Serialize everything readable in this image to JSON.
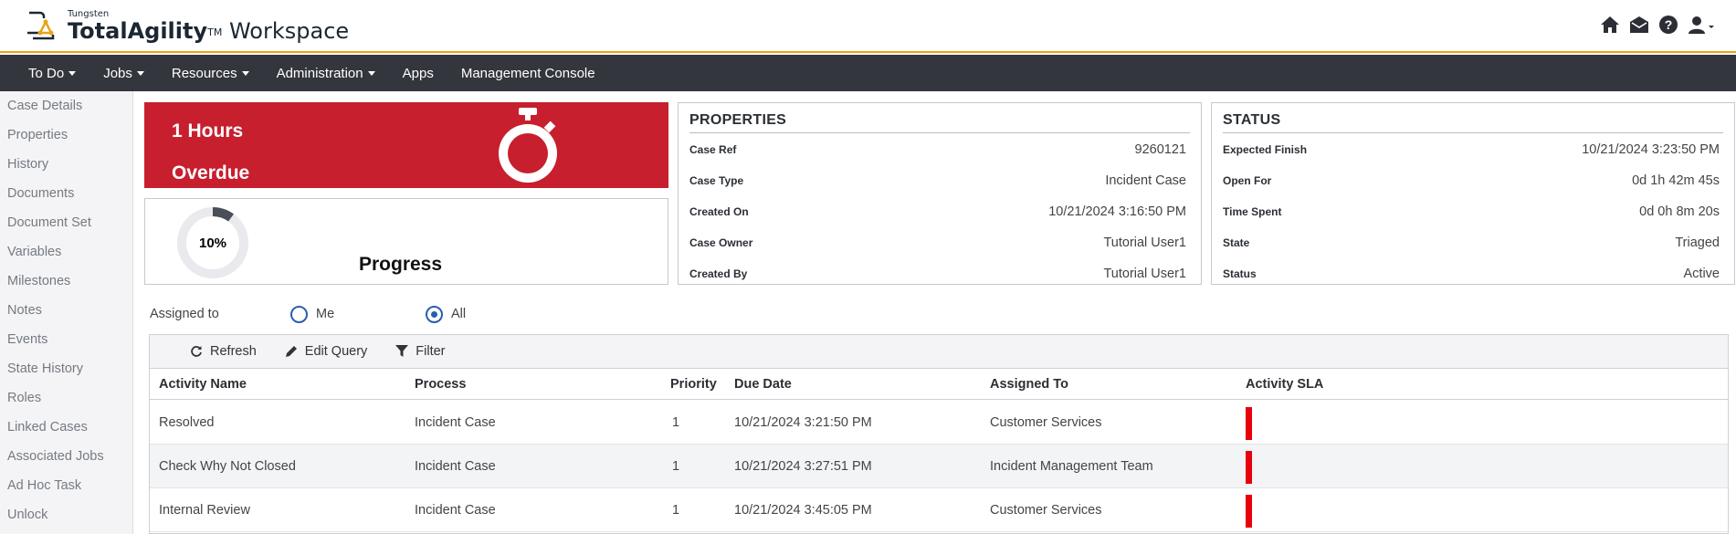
{
  "header": {
    "brand_small": "Tungsten",
    "brand_bold": "TotalAgility",
    "brand_tm": "TM",
    "brand_rest": " Workspace",
    "icons": [
      "home-icon",
      "mail-icon",
      "help-icon",
      "user-icon"
    ]
  },
  "nav": {
    "items": [
      {
        "label": "To Do",
        "dropdown": true
      },
      {
        "label": "Jobs",
        "dropdown": true
      },
      {
        "label": "Resources",
        "dropdown": true
      },
      {
        "label": "Administration",
        "dropdown": true
      },
      {
        "label": "Apps",
        "dropdown": false
      },
      {
        "label": "Management Console",
        "dropdown": false
      }
    ]
  },
  "sidebar": {
    "items": [
      {
        "label": "Case Details"
      },
      {
        "label": "Properties"
      },
      {
        "label": "History"
      },
      {
        "label": "Documents"
      },
      {
        "label": "Document Set"
      },
      {
        "label": "Variables"
      },
      {
        "label": "Milestones"
      },
      {
        "label": "Notes"
      },
      {
        "label": "Events"
      },
      {
        "label": "State History"
      },
      {
        "label": "Roles"
      },
      {
        "label": "Linked Cases"
      },
      {
        "label": "Associated Jobs"
      },
      {
        "label": "Ad Hoc Task"
      },
      {
        "label": "Unlock"
      }
    ]
  },
  "overdue": {
    "line1": "1 Hours",
    "line2": "Overdue",
    "color": "#c71f2e",
    "icon": "stopwatch-icon"
  },
  "progress": {
    "percent_label": "10%",
    "percent": 10,
    "title": "Progress"
  },
  "properties": {
    "title": "PROPERTIES",
    "rows": [
      {
        "label": "Case Ref",
        "value": "9260121"
      },
      {
        "label": "Case Type",
        "value": "Incident Case"
      },
      {
        "label": "Created On",
        "value": "10/21/2024 3:16:50 PM"
      },
      {
        "label": "Case Owner",
        "value": "Tutorial User1"
      },
      {
        "label": "Created By",
        "value": "Tutorial User1"
      }
    ]
  },
  "status": {
    "title": "STATUS",
    "rows": [
      {
        "label": "Expected Finish",
        "value": "10/21/2024 3:23:50 PM"
      },
      {
        "label": "Open For",
        "value": "0d 1h 42m 45s"
      },
      {
        "label": "Time Spent",
        "value": "0d 0h 8m 20s"
      },
      {
        "label": "State",
        "value": "Triaged"
      },
      {
        "label": "Status",
        "value": "Active"
      }
    ]
  },
  "assigned": {
    "label": "Assigned to",
    "options": [
      {
        "label": "Me",
        "checked": false
      },
      {
        "label": "All",
        "checked": true
      }
    ]
  },
  "toolbar": {
    "refresh": "Refresh",
    "edit_query": "Edit Query",
    "filter": "Filter"
  },
  "table": {
    "columns": [
      "Activity Name",
      "Process",
      "Priority",
      "Due Date",
      "Assigned To",
      "Activity SLA"
    ],
    "rows": [
      {
        "activity": "Resolved",
        "process": "Incident Case",
        "priority": "1",
        "due": "10/21/2024 3:21:50 PM",
        "assigned": "Customer Services",
        "sla_color": "#e8000b"
      },
      {
        "activity": "Check Why Not Closed",
        "process": "Incident Case",
        "priority": "1",
        "due": "10/21/2024 3:27:51 PM",
        "assigned": "Incident Management Team",
        "sla_color": "#e8000b"
      },
      {
        "activity": "Internal Review",
        "process": "Incident Case",
        "priority": "1",
        "due": "10/21/2024 3:45:05 PM",
        "assigned": "Customer Services",
        "sla_color": "#e8000b"
      }
    ]
  },
  "colors": {
    "accent": "#e8a317",
    "nav_bg": "#33363c",
    "radio": "#2a5db0"
  }
}
